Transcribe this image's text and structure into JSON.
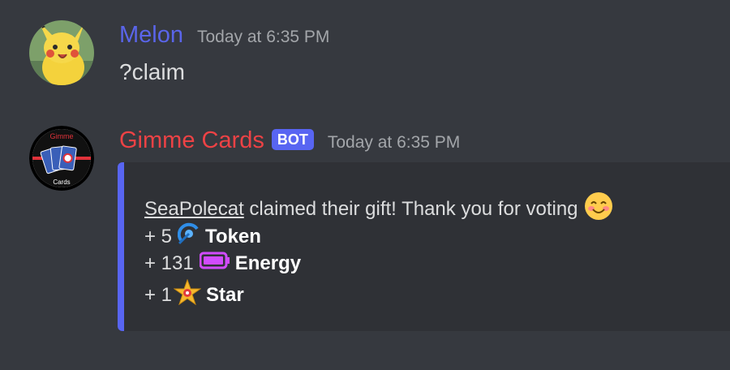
{
  "message1": {
    "username": "Melon",
    "username_color": "#5a65ea",
    "timestamp": "Today at 6:35 PM",
    "content": "?claim"
  },
  "message2": {
    "username": "Gimme Cards",
    "username_color": "#ed4245",
    "bot_tag": "BOT",
    "timestamp": "Today at 6:35 PM",
    "avatar_text_top": "Gimme",
    "avatar_text_bottom": "Cards",
    "embed": {
      "accent": "#5865f2",
      "mention": "SeaPolecat",
      "intro": " claimed their gift! Thank you for voting",
      "rewards": [
        {
          "prefix": "+ 5",
          "icon": "token-icon",
          "label": "Token"
        },
        {
          "prefix": "+ 131",
          "icon": "energy-icon",
          "label": "Energy"
        },
        {
          "prefix": "+ 1",
          "icon": "star-icon",
          "label": "Star"
        }
      ]
    }
  }
}
